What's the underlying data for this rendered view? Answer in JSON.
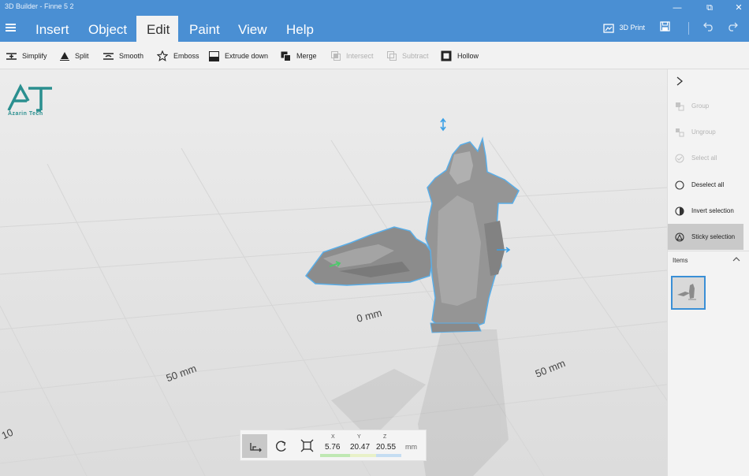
{
  "app": {
    "title": "3D Builder - Finne 5 2"
  },
  "menu": {
    "tabs": [
      {
        "label": "Insert"
      },
      {
        "label": "Object"
      },
      {
        "label": "Edit"
      },
      {
        "label": "Paint"
      },
      {
        "label": "View"
      },
      {
        "label": "Help"
      }
    ],
    "print_label": "3D Print"
  },
  "ribbon": {
    "simplify": "Simplify",
    "split": "Split",
    "smooth": "Smooth",
    "emboss": "Emboss",
    "extrude": "Extrude down",
    "merge": "Merge",
    "intersect": "Intersect",
    "subtract": "Subtract",
    "hollow": "Hollow"
  },
  "viewport": {
    "logo_text": "Azarin Tech",
    "axis_labels": {
      "center": "0 mm",
      "left": "50 mm",
      "right": "50 mm",
      "far_left": "10"
    }
  },
  "transform": {
    "x_label": "X",
    "x": "5.76",
    "y_label": "Y",
    "y": "20.47",
    "z_label": "Z",
    "z": "20.55",
    "unit": "mm"
  },
  "panel": {
    "group": "Group",
    "ungroup": "Ungroup",
    "select_all": "Select all",
    "deselect_all": "Deselect all",
    "invert_selection": "Invert selection",
    "sticky_selection": "Sticky selection",
    "items_label": "Items"
  },
  "colors": {
    "accent": "#4a8fd3",
    "selection": "#3aa0e6"
  }
}
